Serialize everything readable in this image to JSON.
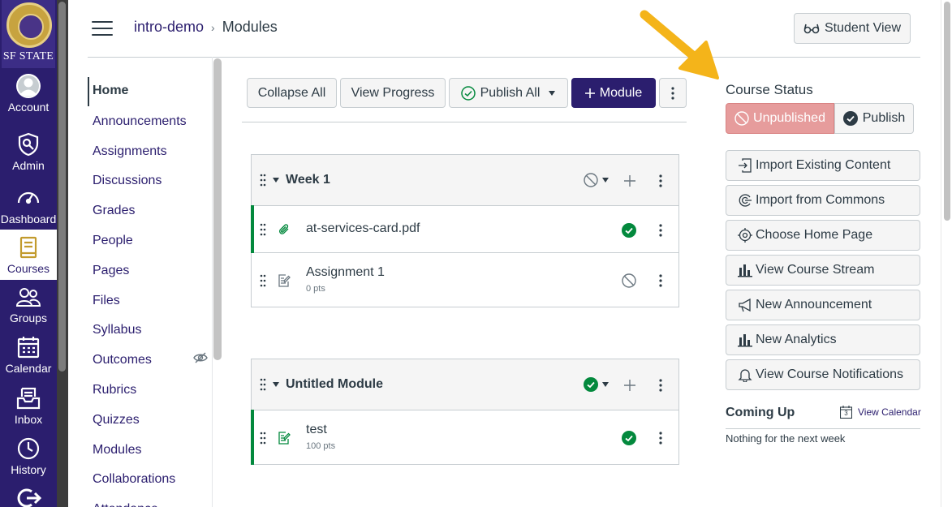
{
  "global_nav": {
    "logo_text": "SF STATE",
    "items": [
      {
        "label": "Account",
        "icon": "account-icon"
      },
      {
        "label": "Admin",
        "icon": "admin-icon"
      },
      {
        "label": "Dashboard",
        "icon": "dashboard-icon"
      },
      {
        "label": "Courses",
        "icon": "courses-icon",
        "active": true
      },
      {
        "label": "Groups",
        "icon": "groups-icon"
      },
      {
        "label": "Calendar",
        "icon": "calendar-icon"
      },
      {
        "label": "Inbox",
        "icon": "inbox-icon"
      },
      {
        "label": "History",
        "icon": "history-icon"
      }
    ]
  },
  "header": {
    "breadcrumb": [
      "intro-demo",
      "Modules"
    ],
    "student_view_label": "Student View"
  },
  "course_nav": {
    "items": [
      "Home",
      "Announcements",
      "Assignments",
      "Discussions",
      "Grades",
      "People",
      "Pages",
      "Files",
      "Syllabus",
      "Outcomes",
      "Rubrics",
      "Quizzes",
      "Modules",
      "Collaborations",
      "Attendance"
    ]
  },
  "toolbar": {
    "collapse_all": "Collapse All",
    "view_progress": "View Progress",
    "publish_all": "Publish All",
    "add_module": "Module"
  },
  "modules": [
    {
      "title": "Week 1",
      "status": "unpublished",
      "items": [
        {
          "name": "at-services-card.pdf",
          "type": "attachment",
          "points": "",
          "status": "published"
        },
        {
          "name": "Assignment 1",
          "type": "assignment",
          "points": "0 pts",
          "status": "unpublished"
        }
      ]
    },
    {
      "title": "Untitled Module",
      "status": "published",
      "items": [
        {
          "name": "test",
          "type": "assignment",
          "points": "100 pts",
          "status": "published"
        }
      ]
    }
  ],
  "sidebar": {
    "course_status_title": "Course Status",
    "unpublished_label": "Unpublished",
    "publish_label": "Publish",
    "buttons": [
      "Import Existing Content",
      "Import from Commons",
      "Choose Home Page",
      "View Course Stream",
      "New Announcement",
      "New Analytics",
      "View Course Notifications"
    ],
    "coming_up_title": "Coming Up",
    "view_calendar_label": "View Calendar",
    "calendar_day": "3",
    "nothing_text": "Nothing for the next week"
  },
  "colors": {
    "brand": "#2b1e6e",
    "published": "#03893d",
    "unpublished_btn": "#e69c9c",
    "annotation_arrow": "#f4b41a"
  }
}
